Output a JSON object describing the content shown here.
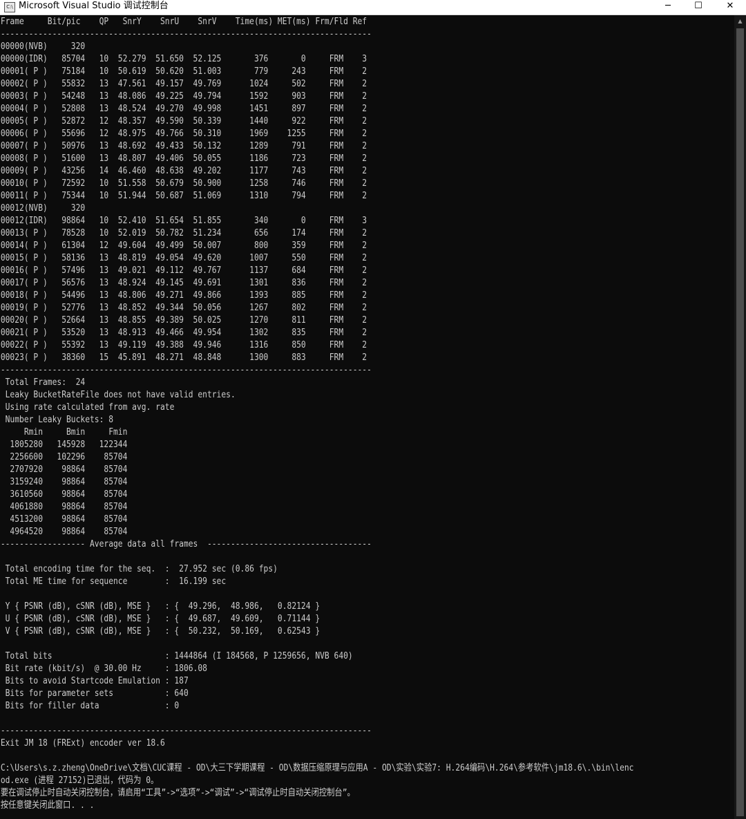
{
  "window": {
    "title": "Microsoft Visual Studio 调试控制台",
    "icon": "vs-debug-console-icon",
    "icon_text": "C:\\",
    "controls": {
      "minimize": "─",
      "maximize": "☐",
      "close": "✕"
    }
  },
  "console": {
    "lines": [
      "Frame     Bit/pic    QP   SnrY    SnrU    SnrV    Time(ms) MET(ms) Frm/Fld Ref",
      "-------------------------------------------------------------------------------",
      "00000(NVB)     320",
      "00000(IDR)   85704   10  52.279  51.650  52.125       376       0     FRM    3",
      "00001( P )   75184   10  50.619  50.620  51.003       779     243     FRM    2",
      "00002( P )   55832   13  47.561  49.157  49.769      1024     502     FRM    2",
      "00003( P )   54248   13  48.086  49.225  49.794      1592     903     FRM    2",
      "00004( P )   52808   13  48.524  49.270  49.998      1451     897     FRM    2",
      "00005( P )   52872   12  48.357  49.590  50.339      1440     922     FRM    2",
      "00006( P )   55696   12  48.975  49.766  50.310      1969    1255     FRM    2",
      "00007( P )   50976   13  48.692  49.433  50.132      1289     791     FRM    2",
      "00008( P )   51600   13  48.807  49.406  50.055      1186     723     FRM    2",
      "00009( P )   43256   14  46.460  48.638  49.202      1177     743     FRM    2",
      "00010( P )   72592   10  51.558  50.679  50.900      1258     746     FRM    2",
      "00011( P )   75344   10  51.944  50.687  51.069      1310     794     FRM    2",
      "00012(NVB)     320",
      "00012(IDR)   98864   10  52.410  51.654  51.855       340       0     FRM    3",
      "00013( P )   78528   10  52.019  50.782  51.234       656     174     FRM    2",
      "00014( P )   61304   12  49.604  49.499  50.007       800     359     FRM    2",
      "00015( P )   58136   13  48.819  49.054  49.620      1007     550     FRM    2",
      "00016( P )   57496   13  49.021  49.112  49.767      1137     684     FRM    2",
      "00017( P )   56576   13  48.924  49.145  49.691      1301     836     FRM    2",
      "00018( P )   54496   13  48.806  49.271  49.866      1393     885     FRM    2",
      "00019( P )   52776   13  48.852  49.344  50.056      1267     802     FRM    2",
      "00020( P )   52664   13  48.855  49.389  50.025      1270     811     FRM    2",
      "00021( P )   53520   13  48.913  49.466  49.954      1302     835     FRM    2",
      "00022( P )   55392   13  49.119  49.388  49.946      1316     850     FRM    2",
      "00023( P )   38360   15  45.891  48.271  48.848      1300     883     FRM    2",
      "-------------------------------------------------------------------------------",
      " Total Frames:  24",
      " Leaky BucketRateFile does not have valid entries.",
      " Using rate calculated from avg. rate",
      " Number Leaky Buckets: 8",
      "     Rmin     Bmin     Fmin",
      "  1805280   145928   122344",
      "  2256600   102296    85704",
      "  2707920    98864    85704",
      "  3159240    98864    85704",
      "  3610560    98864    85704",
      "  4061880    98864    85704",
      "  4513200    98864    85704",
      "  4964520    98864    85704",
      "------------------ Average data all frames  -----------------------------------",
      "",
      " Total encoding time for the seq.  :  27.952 sec (0.86 fps)",
      " Total ME time for sequence        :  16.199 sec",
      "",
      " Y { PSNR (dB), cSNR (dB), MSE }   : {  49.296,  48.986,   0.82124 }",
      " U { PSNR (dB), cSNR (dB), MSE }   : {  49.687,  49.609,   0.71144 }",
      " V { PSNR (dB), cSNR (dB), MSE }   : {  50.232,  50.169,   0.62543 }",
      "",
      " Total bits                        : 1444864 (I 184568, P 1259656, NVB 640)",
      " Bit rate (kbit/s)  @ 30.00 Hz     : 1806.08",
      " Bits to avoid Startcode Emulation : 187",
      " Bits for parameter sets           : 640",
      " Bits for filler data              : 0",
      "",
      "-------------------------------------------------------------------------------",
      "Exit JM 18 (FRExt) encoder ver 18.6",
      "",
      "C:\\Users\\s.z.zheng\\OneDrive\\文档\\CUC课程 - OD\\大三下学期课程 - OD\\数据压缩原理与应用A - OD\\实验\\实验7: H.264编码\\H.264\\参考软件\\jm18.6\\.\\bin\\lenc",
      "od.exe (进程 27152)已退出，代码为 0。",
      "要在调试停止时自动关闭控制台，请启用“工具”->“选项”->“调试”->“调试停止时自动关闭控制台”。",
      "按任意键关闭此窗口. . ."
    ]
  },
  "scrollbar": {
    "up_arrow": "▲"
  },
  "colors": {
    "console_background": "#0c0c0c",
    "console_text": "#cccccc",
    "titlebar_background": "#ffffff"
  }
}
